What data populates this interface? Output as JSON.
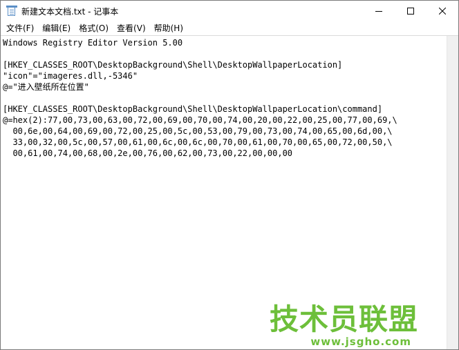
{
  "window": {
    "title": "新建文本文档.txt - 记事本",
    "icon": "notepad-icon",
    "buttons": {
      "minimize": "minimize-icon",
      "maximize": "maximize-icon",
      "close": "close-icon"
    }
  },
  "menu": {
    "items": [
      {
        "label": "文件(F)"
      },
      {
        "label": "编辑(E)"
      },
      {
        "label": "格式(O)"
      },
      {
        "label": "查看(V)"
      },
      {
        "label": "帮助(H)"
      }
    ]
  },
  "editor": {
    "lines": [
      "Windows Registry Editor Version 5.00",
      "",
      "[HKEY_CLASSES_ROOT\\DesktopBackground\\Shell\\DesktopWallpaperLocation]",
      "\"icon\"=\"imageres.dll,-5346\"",
      "@=\"进入壁纸所在位置\"",
      "",
      "[HKEY_CLASSES_ROOT\\DesktopBackground\\Shell\\DesktopWallpaperLocation\\command]",
      "@=hex(2):77,00,73,00,63,00,72,00,69,00,70,00,74,00,20,00,22,00,25,00,77,00,69,\\",
      "  00,6e,00,64,00,69,00,72,00,25,00,5c,00,53,00,79,00,73,00,74,00,65,00,6d,00,\\",
      "  33,00,32,00,5c,00,57,00,61,00,6c,00,6c,00,70,00,61,00,70,00,65,00,72,00,50,\\",
      "  00,61,00,74,00,68,00,2e,00,76,00,62,00,73,00,22,00,00,00"
    ]
  },
  "watermark": {
    "title": "技术员联盟",
    "url": "www.jsgho.com"
  },
  "colors": {
    "watermark": "#6dbf3a",
    "text": "#000000",
    "window_border": "#7a7a7a"
  }
}
